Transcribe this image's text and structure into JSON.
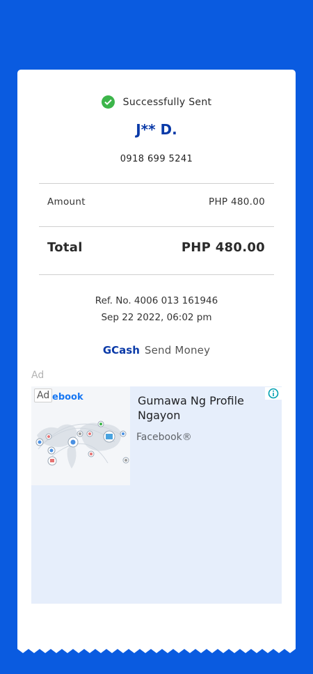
{
  "status": {
    "text": "Successfully Sent",
    "icon": "check-circle-icon",
    "color": "#3cb54a"
  },
  "recipient": {
    "name": "J** D.",
    "phone": "0918 699 5241"
  },
  "amount": {
    "label": "Amount",
    "value": "PHP 480.00"
  },
  "total": {
    "label": "Total",
    "value": "PHP 480.00"
  },
  "reference": {
    "ref_no": "Ref. No. 4006 013 161946",
    "datetime": "Sep 22 2022, 06:02 pm"
  },
  "branding": {
    "brand": "GCash",
    "service": "Send Money"
  },
  "ad": {
    "label": "Ad",
    "badge": "Ad",
    "image_logo_text": "ebook",
    "headline": "Gumawa Ng Profile Ngayon",
    "advertiser": "Facebook®",
    "info_icon": "info-icon"
  },
  "colors": {
    "background": "#0a5be0",
    "brand_blue": "#0a3aa8",
    "ad_bg": "#e6eefb"
  }
}
